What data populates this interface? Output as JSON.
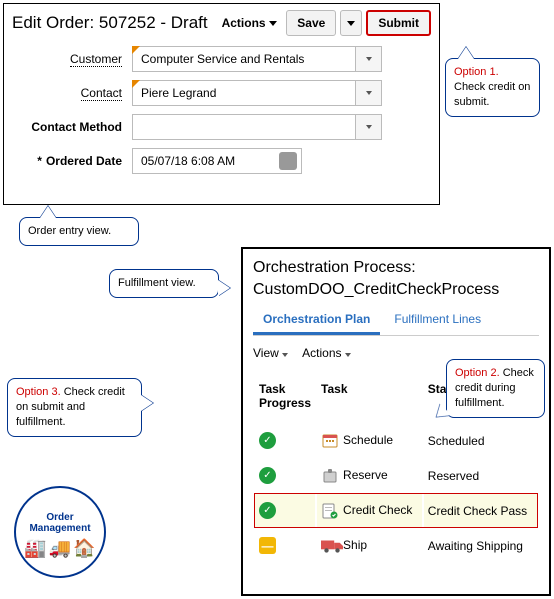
{
  "order_panel": {
    "title": "Edit Order: 507252 - Draft",
    "actions_label": "Actions",
    "save_label": "Save",
    "submit_label": "Submit",
    "fields": {
      "customer": {
        "label": "Customer",
        "value": "Computer Service and Rentals"
      },
      "contact": {
        "label": "Contact",
        "value": "Piere Legrand"
      },
      "contact_method": {
        "label": "Contact Method",
        "value": ""
      },
      "ordered_date": {
        "label": "Ordered Date",
        "required_marker": "*",
        "value": "05/07/18 6:08 AM"
      }
    }
  },
  "callouts": {
    "opt1": {
      "opt": "Option 1.",
      "text": "Check credit on submit."
    },
    "order_view": "Order entry view.",
    "fulfillment_view": "Fulfillment view.",
    "opt2": {
      "opt": "Option 2.",
      "text": "Check credit during fulfillment."
    },
    "opt3": {
      "opt": "Option 3.",
      "text": "Check credit on submit and fulfillment."
    }
  },
  "orch_panel": {
    "title_line1": "Orchestration Process:",
    "title_line2": "CustomDOO_CreditCheckProcess",
    "tabs": {
      "plan": "Orchestration Plan",
      "lines": "Fulfillment Lines"
    },
    "toolbar": {
      "view": "View",
      "actions": "Actions"
    },
    "columns": {
      "progress": "Task Progress",
      "task": "Task",
      "status": "Status"
    },
    "rows": [
      {
        "progress": "ok",
        "task": "Schedule",
        "status": "Scheduled",
        "highlight": false
      },
      {
        "progress": "ok",
        "task": "Reserve",
        "status": "Reserved",
        "highlight": false
      },
      {
        "progress": "ok",
        "task": "Credit Check",
        "status": "Credit Check Pass",
        "highlight": true
      },
      {
        "progress": "pending",
        "task": "Ship",
        "status": "Awaiting Shipping",
        "highlight": false
      }
    ]
  },
  "seal": {
    "line1": "Order",
    "line2": "Management"
  }
}
